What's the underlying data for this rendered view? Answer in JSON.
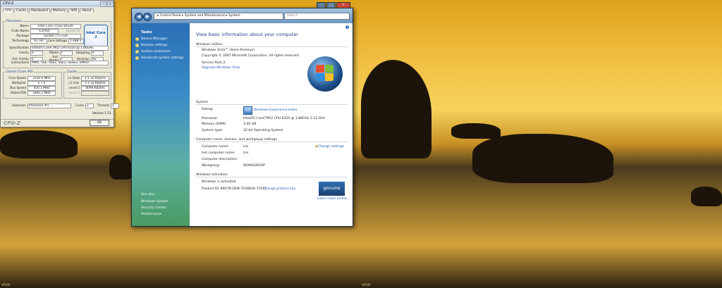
{
  "cpuz": {
    "title": "CPU-Z",
    "tabs": [
      "CPU",
      "Cache",
      "Mainboard",
      "Memory",
      "SPD",
      "About"
    ],
    "processor_group": "Processor",
    "fields": [
      {
        "label": "Name",
        "value": "Intel Core 2 Duo E6320"
      },
      {
        "label": "Code Name",
        "value": "Conroe"
      },
      {
        "label": "Package",
        "value": "Socket 775 LGA"
      },
      {
        "label": "Technology",
        "value": "65 nm"
      }
    ],
    "brand_id": "Brand ID",
    "core_voltage_label": "Core Voltage",
    "core_voltage": "1.488 V",
    "spec_label": "Specification",
    "spec_value": "Intel(R) Core(TM)2 CPU     6320 @ 1.86GHz",
    "family_label": "Family",
    "family": "6",
    "model_label": "Model",
    "model": "F",
    "stepping_label": "Stepping",
    "stepping": "6",
    "ext_family_label": "Ext. Family",
    "ext_family": "6",
    "ext_model_label": "Ext. Model",
    "ext_model": "F",
    "revision_label": "Revision",
    "revision": "B2",
    "instructions_label": "Instructions",
    "instructions": "MMX, SSE, SSE2, SSE3, SSSE3, EM64T",
    "clocks_group": "Clocks (Core #0)",
    "clocks": [
      {
        "label": "Core Speed",
        "value": "3150.6 MHz"
      },
      {
        "label": "Multiplier",
        "value": "x 7.0"
      },
      {
        "label": "Bus Speed",
        "value": "450.1 MHz"
      },
      {
        "label": "Rated FSB",
        "value": "1800.2 MHz"
      }
    ],
    "cache_group": "Cache",
    "cache": [
      {
        "label": "L1 Data",
        "value": "2 x 32 KBytes"
      },
      {
        "label": "L1 Inst.",
        "value": "2 x 32 KBytes"
      },
      {
        "label": "Level 2",
        "value": "4096 KBytes"
      },
      {
        "label": "Level 3",
        "value": ""
      }
    ],
    "selection_label": "Selection",
    "selection": "Processor #1",
    "cores_label": "Cores",
    "cores": "2",
    "threads_label": "Threads",
    "threads": "2",
    "version": "Version 1.51",
    "brand": "CPU-Z",
    "ok": "OK",
    "intel_logo": "intel Core 2"
  },
  "cp": {
    "back": "◀",
    "forward": "▶",
    "address": "▸ Control Panel ▸ System and Maintenance ▸ System",
    "search_placeholder": "Search",
    "tasks_heading": "Tasks",
    "tasks": [
      "Device Manager",
      "Remote settings",
      "System protection",
      "Advanced system settings"
    ],
    "see_also": "See also",
    "see_also_links": [
      "Windows Update",
      "Security Center",
      "Performance"
    ],
    "heading": "View basic information about your computer",
    "edition_section": "Windows edition",
    "edition": "Windows Vista™ Home Premium",
    "copyright": "Copyright © 2007 Microsoft Corporation.  All rights reserved.",
    "service_pack": "Service Pack 2",
    "upgrade_link": "Upgrade Windows Vista",
    "system_section": "System",
    "rating_label": "Rating:",
    "rating_value": "5.9",
    "rating_link": "Windows Experience Index",
    "processor_label": "Processor:",
    "processor_value": "Intel(R) Core(TM)2 CPU        6320  @ 1.86GHz    3.15 GHz",
    "memory_label": "Memory (RAM):",
    "memory_value": "3.00 GB",
    "systype_label": "System type:",
    "systype_value": "32-bit Operating System",
    "name_section": "Computer name, domain, and workgroup settings",
    "computer_name_label": "Computer name:",
    "computer_name": "lsis",
    "full_name_label": "Full computer name:",
    "full_name": "lsis",
    "desc_label": "Computer description:",
    "workgroup_label": "Workgroup:",
    "workgroup": "WORKGROUP",
    "change_settings": "Change settings",
    "activation_section": "Windows activation",
    "activated": "Windows is activated",
    "product_id_label": "Product ID: 89578-OEM-7038834-71972",
    "change_key": "Change product key",
    "genuine_text": "genuine",
    "learn_more": "Learn more online..."
  },
  "watermark": "vivo"
}
